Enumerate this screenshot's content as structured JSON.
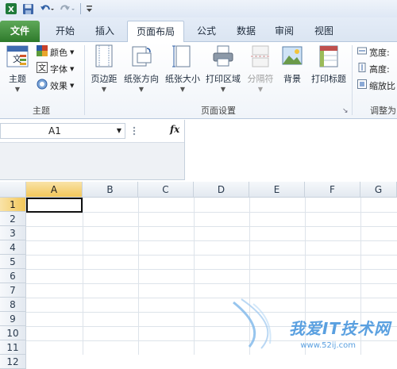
{
  "quick_access": {
    "items": [
      "excel-logo-icon",
      "save-icon",
      "undo-icon",
      "redo-icon",
      "customize-icon"
    ]
  },
  "tabs": {
    "file": "文件",
    "home": "开始",
    "insert": "插入",
    "page_layout": "页面布局",
    "formulas": "公式",
    "data": "数据",
    "review": "审阅",
    "view": "视图"
  },
  "ribbon": {
    "themes": {
      "themes_label": "主题",
      "colors": "颜色",
      "fonts": "字体",
      "effects": "效果",
      "group_label": "主题"
    },
    "page_setup": {
      "margins": "页边距",
      "orientation": "纸张方向",
      "size": "纸张大小",
      "print_area": "打印区域",
      "breaks": "分隔符",
      "background": "背景",
      "print_titles": "打印标题",
      "group_label": "页面设置"
    },
    "scale_to_fit": {
      "width": "宽度:",
      "height": "高度:",
      "scale": "缩放比",
      "group_label": "调整为"
    }
  },
  "formula_bar": {
    "name_box": "A1",
    "fx_label": "fx",
    "formula": ""
  },
  "grid": {
    "columns": [
      "A",
      "B",
      "C",
      "D",
      "E",
      "F",
      "G"
    ],
    "rows": [
      "1",
      "2",
      "3",
      "4",
      "5",
      "6",
      "7",
      "8",
      "9",
      "10",
      "11",
      "12"
    ],
    "selected_cell": "A1"
  },
  "watermark": {
    "text": "我爱IT技术网",
    "url": "www.52ij.com"
  }
}
